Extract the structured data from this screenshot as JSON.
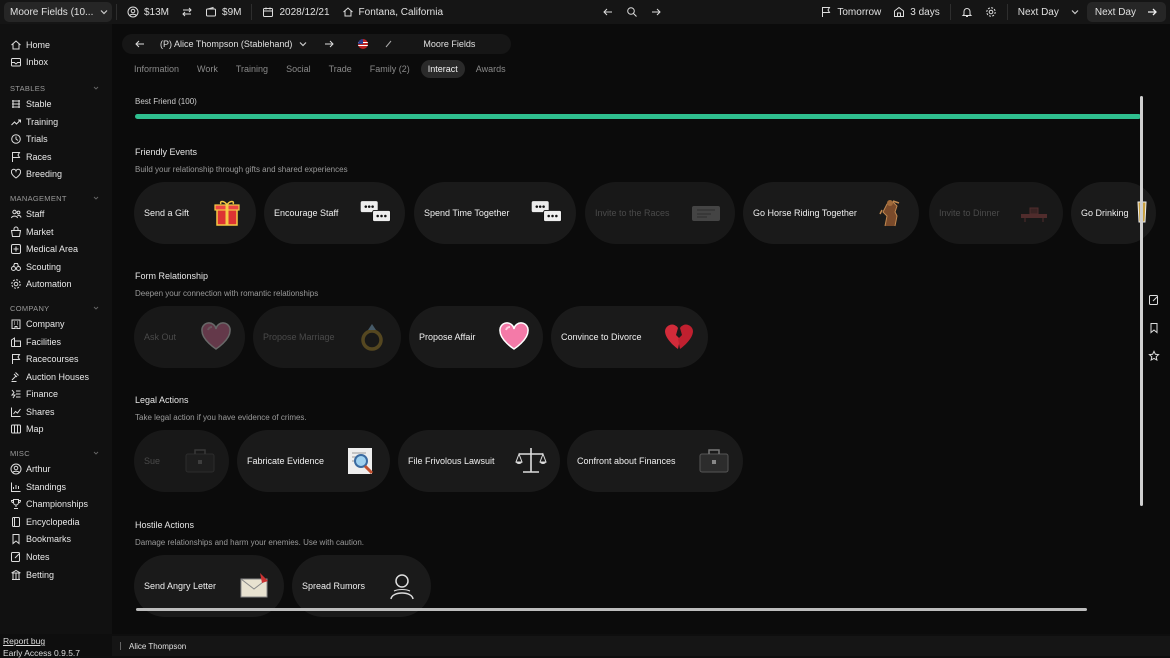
{
  "topbar": {
    "save_label": "Moore Fields (10...",
    "cash": "$13M",
    "value": "$9M",
    "date": "2028/12/21",
    "location": "Fontana, California",
    "tomorrow": "Tomorrow",
    "days": "3 days",
    "next_day_dropdown": "Next Day",
    "next_day_button": "Next Day"
  },
  "sidebar": {
    "top": [
      {
        "label": "Home",
        "icon": "home-icon"
      },
      {
        "label": "Inbox",
        "icon": "inbox-icon"
      }
    ],
    "groups": [
      {
        "heading": "STABLES",
        "items": [
          "Stable",
          "Training",
          "Trials",
          "Races",
          "Breeding"
        ]
      },
      {
        "heading": "MANAGEMENT",
        "items": [
          "Staff",
          "Market",
          "Medical Area",
          "Scouting",
          "Automation"
        ]
      },
      {
        "heading": "COMPANY",
        "items": [
          "Company",
          "Facilities",
          "Racecourses",
          "Auction Houses",
          "Finance",
          "Shares",
          "Map"
        ]
      },
      {
        "heading": "MISC",
        "items": [
          "Arthur",
          "Standings",
          "Championships",
          "Encyclopedia",
          "Bookmarks",
          "Notes",
          "Betting"
        ]
      }
    ],
    "report_bug": "Report bug",
    "version": "Early Access 0.9.5.7"
  },
  "person_bar": {
    "name": "(P) Alice Thompson (Stablehand)",
    "employer": "Moore Fields"
  },
  "tabs": [
    {
      "label": "Information",
      "active": false
    },
    {
      "label": "Work",
      "active": false
    },
    {
      "label": "Training",
      "active": false
    },
    {
      "label": "Social",
      "active": false
    },
    {
      "label": "Trade",
      "active": false
    },
    {
      "label": "Family (2)",
      "active": false
    },
    {
      "label": "Interact",
      "active": true
    },
    {
      "label": "Awards",
      "active": false
    }
  ],
  "relationship": {
    "label": "Best Friend (100)",
    "value": 100,
    "color": "#2fbf8f"
  },
  "sections": {
    "friendly": {
      "title": "Friendly Events",
      "subtitle": "Build your relationship through gifts and shared experiences",
      "cards": [
        {
          "label": "Send a Gift",
          "icon": "gift-icon",
          "enabled": true
        },
        {
          "label": "Encourage Staff",
          "icon": "speech-bubbles-icon",
          "enabled": true
        },
        {
          "label": "Spend Time Together",
          "icon": "speech-bubbles-icon",
          "enabled": true
        },
        {
          "label": "Invite to the Races",
          "icon": "ticket-icon",
          "enabled": false
        },
        {
          "label": "Go Horse Riding Together",
          "icon": "horse-icon",
          "enabled": true
        },
        {
          "label": "Invite to Dinner",
          "icon": "dinner-icon",
          "enabled": false
        },
        {
          "label": "Go Drinking",
          "icon": "drink-icon",
          "enabled": true
        }
      ]
    },
    "romance": {
      "title": "Form Relationship",
      "subtitle": "Deepen your connection with romantic relationships",
      "cards": [
        {
          "label": "Ask Out",
          "icon": "heart-icon",
          "enabled": false
        },
        {
          "label": "Propose Marriage",
          "icon": "ring-icon",
          "enabled": false
        },
        {
          "label": "Propose Affair",
          "icon": "heart-icon",
          "enabled": true
        },
        {
          "label": "Convince to Divorce",
          "icon": "broken-heart-icon",
          "enabled": true
        }
      ]
    },
    "legal": {
      "title": "Legal Actions",
      "subtitle": "Take legal action if you have evidence of crimes.",
      "cards": [
        {
          "label": "Sue",
          "icon": "briefcase-icon",
          "enabled": false
        },
        {
          "label": "Fabricate Evidence",
          "icon": "magnifier-icon",
          "enabled": true
        },
        {
          "label": "File Frivolous Lawsuit",
          "icon": "scales-icon",
          "enabled": true
        },
        {
          "label": "Confront about Finances",
          "icon": "briefcase-icon",
          "enabled": true
        }
      ]
    },
    "hostile": {
      "title": "Hostile Actions",
      "subtitle": "Damage relationships and harm your enemies. Use with caution.",
      "cards": [
        {
          "label": "Send Angry Letter",
          "icon": "letter-icon",
          "enabled": true
        },
        {
          "label": "Spread Rumors",
          "icon": "whisper-icon",
          "enabled": true
        }
      ]
    }
  },
  "statusbar": {
    "name": "Alice Thompson"
  }
}
